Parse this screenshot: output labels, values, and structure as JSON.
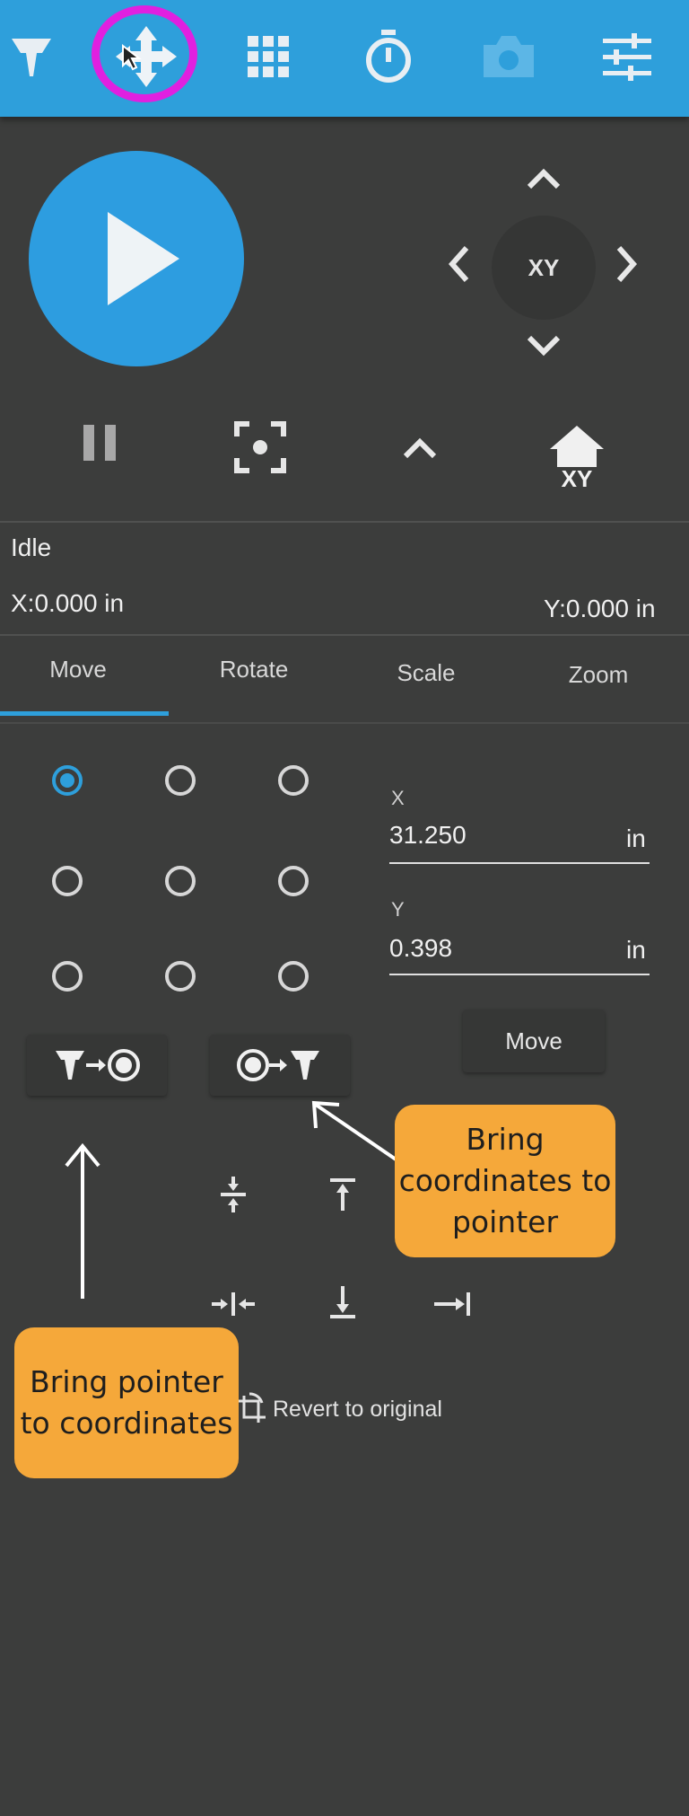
{
  "toolbar": {
    "icons": [
      "laser-head-icon",
      "move-arrows-icon",
      "grid-icon",
      "stopwatch-icon",
      "camera-icon",
      "sliders-icon"
    ],
    "accent": "#2e9fdb",
    "highlight_color": "#e020e0"
  },
  "jog": {
    "center_label": "XY"
  },
  "controls": {
    "home_label": "XY"
  },
  "status": {
    "state": "Idle",
    "x": "X:0.000 in",
    "y": "Y:0.000 in"
  },
  "tabs": [
    {
      "label": "Move",
      "active": true
    },
    {
      "label": "Rotate",
      "active": false
    },
    {
      "label": "Scale",
      "active": false
    },
    {
      "label": "Zoom",
      "active": false
    }
  ],
  "move_panel": {
    "selected_anchor": "top-left",
    "x_label": "X",
    "x_value": "31.250",
    "x_unit": "in",
    "y_label": "Y",
    "y_value": "0.398",
    "y_unit": "in",
    "move_label": "Move",
    "revert_label": "Revert to original"
  },
  "annotations": {
    "right_callout": "Bring coordinates to pointer",
    "left_callout": "Bring pointer to coordinates",
    "callout_color": "#f5a83a"
  }
}
